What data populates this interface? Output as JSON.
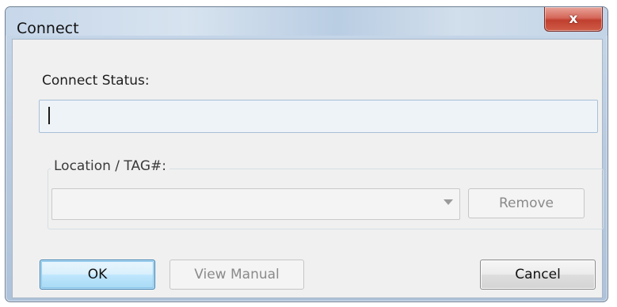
{
  "window": {
    "title": "Connect",
    "close_glyph": "x"
  },
  "connect_status": {
    "label": "Connect Status:",
    "value": ""
  },
  "location": {
    "group_label": "Location / TAG#:",
    "combo_value": "",
    "remove_label": "Remove"
  },
  "buttons": {
    "ok_label": "OK",
    "view_manual_label": "View Manual",
    "cancel_label": "Cancel"
  },
  "icons": {
    "close": "close-icon",
    "dropdown": "chevron-down-icon"
  }
}
